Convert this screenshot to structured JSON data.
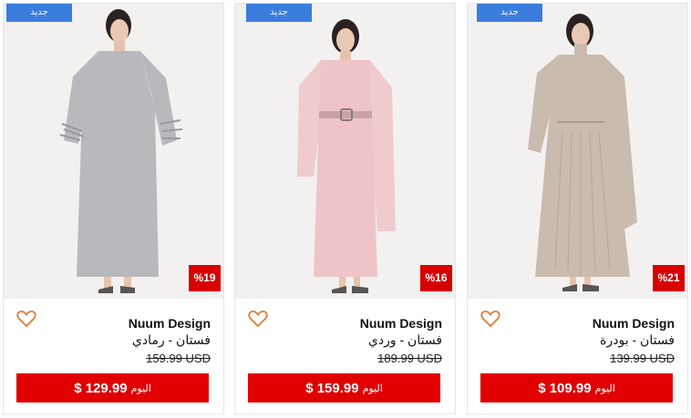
{
  "products": [
    {
      "badge_new": "جديد",
      "discount": "%21",
      "brand": "Nuum Design",
      "title": "فستان - بودرة",
      "old_price": "139.99 USD",
      "today_label": "اليوم",
      "price": "$ 109.99",
      "dress_color": "#c9bcae"
    },
    {
      "badge_new": "جديد",
      "discount": "%16",
      "brand": "Nuum Design",
      "title": "فستان - وردي",
      "old_price": "189.99 USD",
      "today_label": "اليوم",
      "price": "$ 159.99",
      "dress_color": "#efc4c8"
    },
    {
      "badge_new": "جديد",
      "discount": "%19",
      "brand": "Nuum Design",
      "title": "فستان - رمادي",
      "old_price": "159.99 USD",
      "today_label": "اليوم",
      "price": "$ 129.99",
      "dress_color": "#b9b9bd"
    }
  ],
  "colors": {
    "badge_new": "#3b7ddd",
    "discount": "#d60000",
    "buy_button": "#e00000",
    "heart": "#e07a3a"
  }
}
